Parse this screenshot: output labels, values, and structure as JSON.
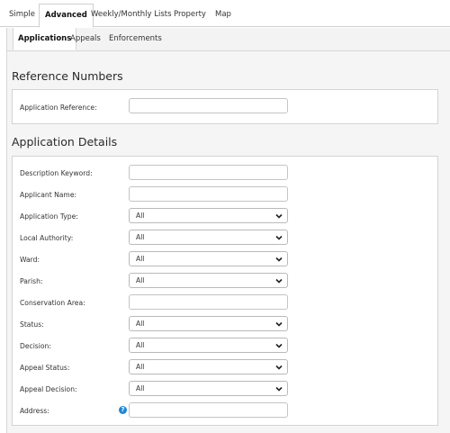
{
  "tabs": [
    "Simple",
    "Advanced",
    "Weekly/Monthly Lists",
    "Property",
    "Map"
  ],
  "active_tab": "Advanced",
  "subtabs": [
    "Applications",
    "Appeals",
    "Enforcements"
  ],
  "active_subtab": "Applications",
  "reference_section": {
    "title": "Reference Numbers",
    "fields": [
      {
        "label": "Application Reference:",
        "type": "text",
        "value": ""
      }
    ]
  },
  "details_section": {
    "title": "Application Details",
    "fields": [
      {
        "label": "Description Keyword:",
        "type": "text",
        "value": ""
      },
      {
        "label": "Applicant Name:",
        "type": "text",
        "value": ""
      },
      {
        "label": "Application Type:",
        "type": "select",
        "value": "All"
      },
      {
        "label": "Local Authority:",
        "type": "select",
        "value": "All"
      },
      {
        "label": "Ward:",
        "type": "select",
        "value": "All"
      },
      {
        "label": "Parish:",
        "type": "select",
        "value": "All"
      },
      {
        "label": "Conservation Area:",
        "type": "text",
        "value": ""
      },
      {
        "label": "Status:",
        "type": "select",
        "value": "All"
      },
      {
        "label": "Decision:",
        "type": "select",
        "value": "All"
      },
      {
        "label": "Appeal Status:",
        "type": "select",
        "value": "All"
      },
      {
        "label": "Appeal Decision:",
        "type": "select",
        "value": "All"
      },
      {
        "label": "Address:",
        "type": "text",
        "value": "",
        "help_icon": "help-question-icon"
      }
    ]
  },
  "colors": {
    "help_icon": "#1f87d6",
    "panel_bg": "#f5f5f5",
    "border": "#d4d4d4"
  }
}
